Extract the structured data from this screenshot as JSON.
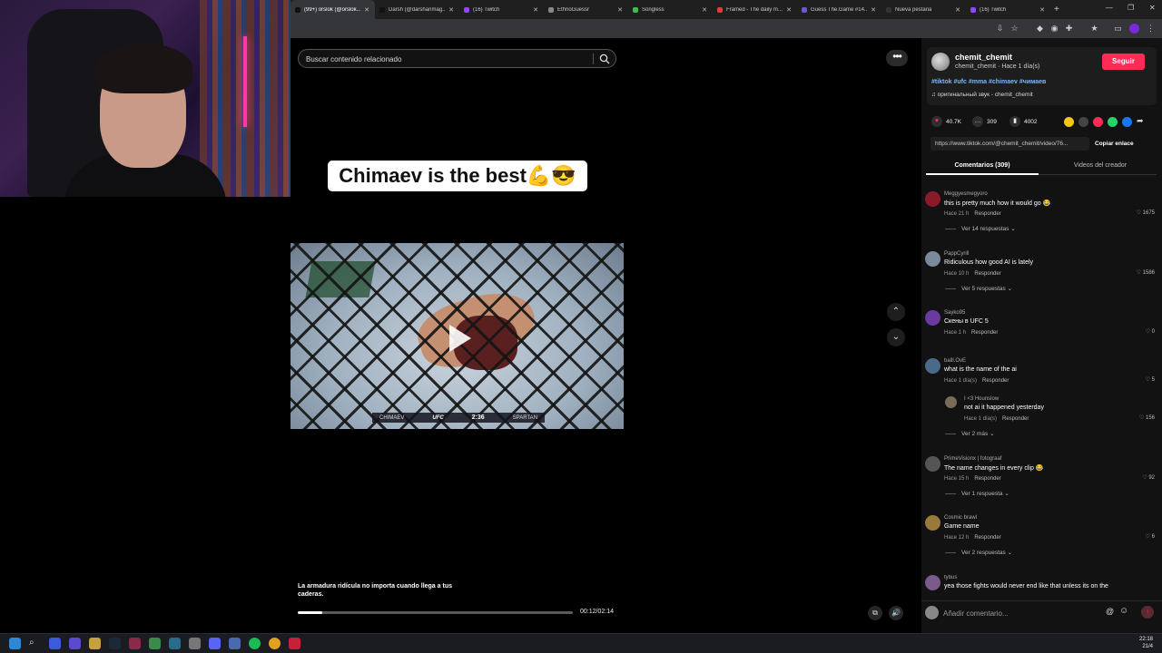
{
  "browser": {
    "tabs": [
      {
        "title": "(99+) orslok (@orslok...",
        "active": true,
        "color": "#111111"
      },
      {
        "title": "Darsh (@darshanmag...",
        "active": false,
        "color": "#111111"
      },
      {
        "title": "(16) Twitch",
        "active": false,
        "color": "#9146ff"
      },
      {
        "title": "EthnoGuessr",
        "active": false,
        "color": "#888888"
      },
      {
        "title": "Songless",
        "active": false,
        "color": "#3fb950"
      },
      {
        "title": "Framed - The daily m...",
        "active": false,
        "color": "#e53935"
      },
      {
        "title": "Guess The.Game #14...",
        "active": false,
        "color": "#6a5acd"
      },
      {
        "title": "Nueva pestaña",
        "active": false,
        "color": "#333333"
      },
      {
        "title": "(16) Twitch",
        "active": false,
        "color": "#9146ff"
      }
    ],
    "new_tab": "+"
  },
  "search": {
    "placeholder": "Buscar contenido relacionado"
  },
  "video": {
    "caption": "Chimaev is the best💪😎",
    "scorebar": {
      "left": "CHIMAEV",
      "brand": "UFC",
      "clock": "2:36",
      "right": "SPARTAN"
    },
    "subtitle": "La armadura ridícula no importa cuando llega a tus caderas.",
    "time": "00:12/02:14",
    "progress": 0.09
  },
  "author": {
    "username": "chemit_chemit",
    "line": "chemit_chemit · Hace 1 día(s)",
    "follow_label": "Seguir",
    "tags": "#tiktok #ufc #mma #chimaev #чимаев",
    "sound": "♫ оригинальный звук - chemit_chemit"
  },
  "stats": {
    "likes": "40.7K",
    "comments": "309",
    "saves": "4002"
  },
  "link": {
    "url": "https://www.tiktok.com/@chemit_chemit/video/76...",
    "copy_label": "Copiar enlace"
  },
  "panel_tabs": {
    "comments": "Comentarios (309)",
    "videos": "Videos del creador"
  },
  "comments": [
    {
      "user": "Meggyesmegyoro",
      "text": "this is pretty much how it would go 😂",
      "time": "Hace 21 h",
      "reply": "Responder",
      "likes": "1675",
      "more": "Ver 14 respuestas ⌄",
      "avatar": "#8a1a2a"
    },
    {
      "user": "PappCyrill",
      "text": "Ridiculous how good AI is lately",
      "time": "Hace 10 h",
      "reply": "Responder",
      "likes": "1586",
      "more": "Ver 5 respuestas ⌄",
      "avatar": "#7a8a9a"
    },
    {
      "user": "Sayko95",
      "text": "Скены в UFC 5",
      "time": "Hace 1 h",
      "reply": "Responder",
      "likes": "0",
      "more": "",
      "avatar": "#6a3aa0"
    },
    {
      "user": "balll.OvE",
      "text": "what is the name of the ai",
      "time": "Hace 1 día(s)",
      "reply": "Responder",
      "likes": "5",
      "more": "",
      "avatar": "#4a6a8a"
    },
    {
      "user": "PrimeVisionx | fotograaf",
      "text": "The name changes in every clip 😂",
      "time": "Hace 15 h",
      "reply": "Responder",
      "likes": "92",
      "more": "Ver 1 respuesta ⌄",
      "avatar": "#555555"
    },
    {
      "user": "Cosmic brawl",
      "text": "Game name",
      "time": "Hace 12 h",
      "reply": "Responder",
      "likes": "6",
      "more": "Ver 2 respuestas ⌄",
      "avatar": "#9a7a3a"
    },
    {
      "user": "tybus",
      "text": "yea those fights would never end like that unless its on the",
      "time": "",
      "reply": "",
      "likes": "",
      "more": "",
      "avatar": "#7a5a8a"
    }
  ],
  "reply": {
    "user": "I <3 Hounslow",
    "text": "not ai it happened yesterday",
    "time": "Hace 1 día(s)",
    "reply": "Responder",
    "likes": "156",
    "more": "Ver 2 más ⌄"
  },
  "composer": {
    "placeholder": "Añadir comentario..."
  },
  "taskbar": {
    "time": "22:18",
    "date": "21/4"
  }
}
